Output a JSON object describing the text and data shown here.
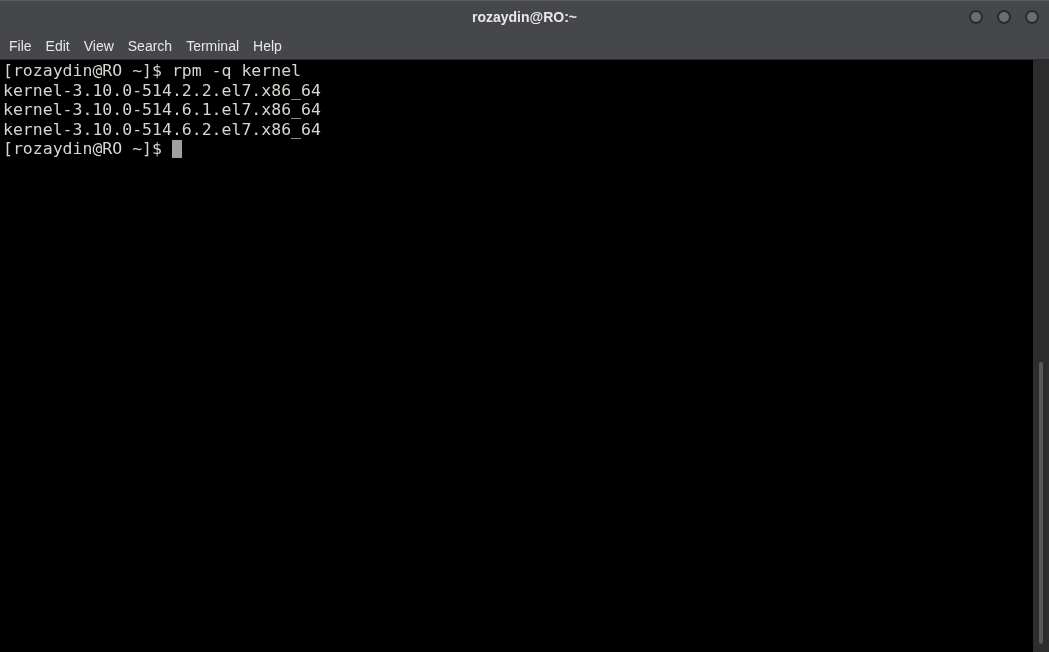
{
  "window": {
    "title": "rozaydin@RO:~"
  },
  "menu": [
    "File",
    "Edit",
    "View",
    "Search",
    "Terminal",
    "Help"
  ],
  "terminal": {
    "lines": [
      {
        "text": "[rozaydin@RO ~]$ rpm -q kernel",
        "cursor": false
      },
      {
        "text": "kernel-3.10.0-514.2.2.el7.x86_64",
        "cursor": false
      },
      {
        "text": "kernel-3.10.0-514.6.1.el7.x86_64",
        "cursor": false
      },
      {
        "text": "kernel-3.10.0-514.6.2.el7.x86_64",
        "cursor": false
      },
      {
        "text": "[rozaydin@RO ~]$ ",
        "cursor": true
      }
    ]
  }
}
